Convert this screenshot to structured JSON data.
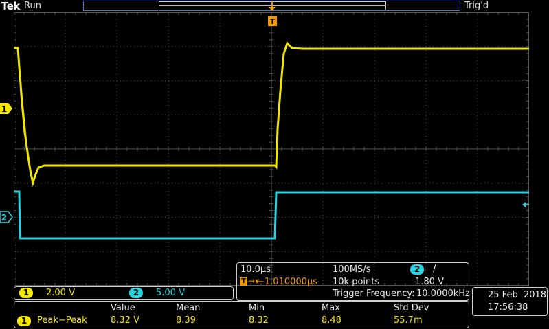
{
  "header": {
    "brand": "Tek",
    "state": "Run",
    "trigger_status": "Trig'd"
  },
  "markers": {
    "trigger_pos": "T",
    "ch1_level": "1",
    "ch2_level": "2"
  },
  "channels": [
    {
      "badge": "1",
      "scale": "2.00 V",
      "color": "#f2e600"
    },
    {
      "badge": "2",
      "scale": "5.00 V",
      "color": "#28d4e0"
    }
  ],
  "acquisition": {
    "time_per_div": "10.0µs",
    "sample_rate": "100MS/s",
    "points": "10k points",
    "trigger_position": "−1.010000µs",
    "trigger_source": "2",
    "trigger_slope": "/",
    "trigger_level": "1.80 V",
    "trigger_frequency_label": "Trigger Frequency:",
    "trigger_frequency_value": "10.0000kHz"
  },
  "datetime": {
    "date": "25 Feb  2018",
    "time": "17:56:38"
  },
  "measurements": {
    "headers": [
      "Value",
      "Mean",
      "Min",
      "Max",
      "Std Dev"
    ],
    "rows": [
      {
        "source": "1",
        "label": "Peak−Peak",
        "value": "8.32 V",
        "mean": "8.39",
        "min": "8.32",
        "max": "8.48",
        "std_dev": "55.7m"
      }
    ]
  },
  "colors": {
    "ch1": "#f2e600",
    "ch2": "#28d4e0",
    "trigger": "#f29a00",
    "grid": "#555555",
    "record_bar": "#3b7ed0"
  }
}
